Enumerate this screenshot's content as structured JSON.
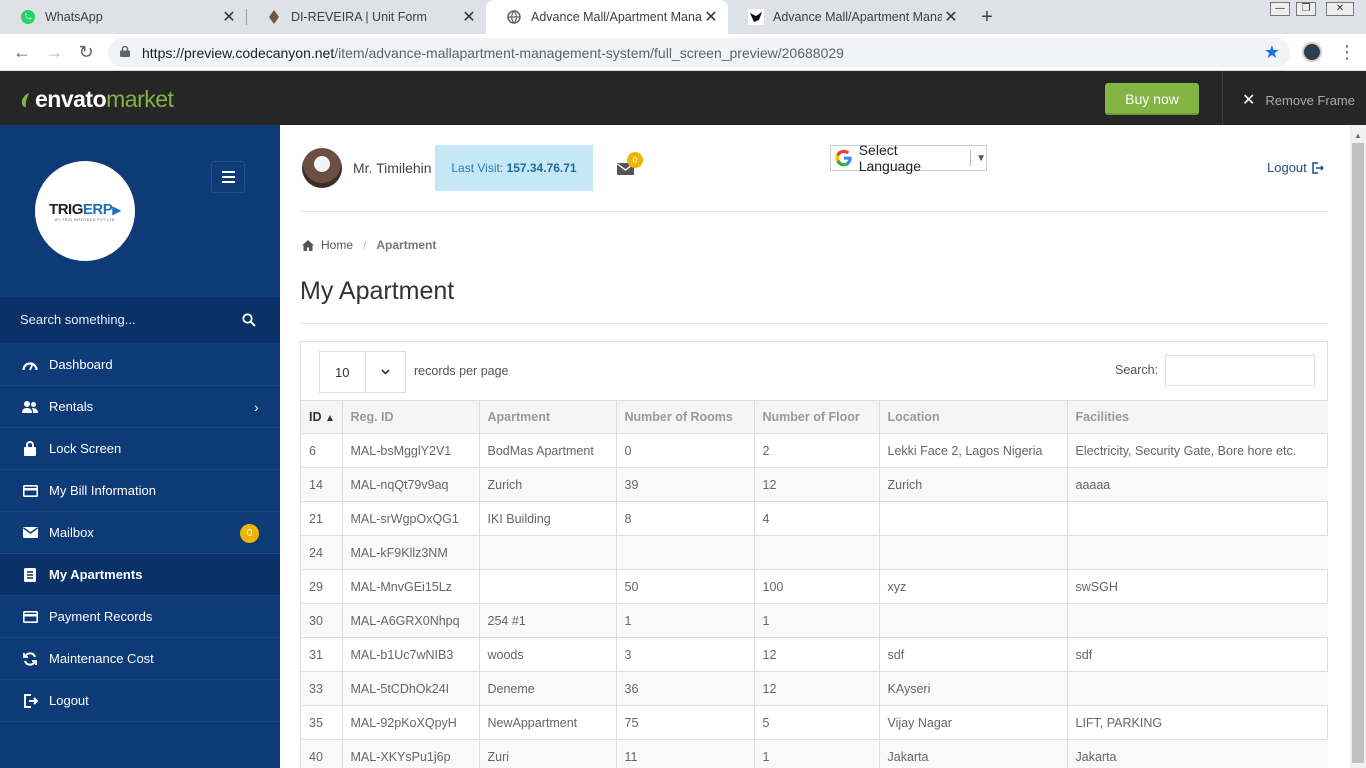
{
  "browser": {
    "tabs": [
      {
        "title": "WhatsApp",
        "icon": "whatsapp-icon"
      },
      {
        "title": "DI-REVEIRA | Unit Form",
        "icon": "diamond-icon"
      },
      {
        "title": "Advance Mall/Apartment Manag",
        "icon": "globe-icon"
      },
      {
        "title": "Advance Mall/Apartment Manag",
        "icon": "bird-icon"
      }
    ],
    "url_host": "https://preview.codecanyon.net",
    "url_path": "/item/advance-mallapartment-management-system/full_screen_preview/20688029"
  },
  "envato": {
    "logo_part1": "envato",
    "logo_part2": "market",
    "buy_now": "Buy now",
    "remove_frame": "Remove Frame",
    "brand_color": "#82b541"
  },
  "sidebar": {
    "logo_main": "TRIG",
    "logo_accent": "ERP",
    "logo_sub": "BY TRIG INFOTECH PVT LTD",
    "search_placeholder": "Search something...",
    "items": [
      {
        "label": "Dashboard",
        "icon": "gauge-icon"
      },
      {
        "label": "Rentals",
        "icon": "users-icon"
      },
      {
        "label": "Lock Screen",
        "icon": "lock-icon"
      },
      {
        "label": "My Bill Information",
        "icon": "card-icon"
      },
      {
        "label": "Mailbox",
        "icon": "envelope-icon",
        "badge": "0"
      },
      {
        "label": "My Apartments",
        "icon": "file-icon"
      },
      {
        "label": "Payment Records",
        "icon": "card-icon"
      },
      {
        "label": "Maintenance Cost",
        "icon": "refresh-icon"
      },
      {
        "label": "Logout",
        "icon": "signout-icon"
      }
    ],
    "bg_color": "#0e3a78"
  },
  "header": {
    "username": "Mr. Timilehin",
    "last_visit_label": "Last Visit:",
    "last_visit_ip": "157.34.76.71",
    "mail_count": "0",
    "language": "Select Language",
    "logout": "Logout"
  },
  "breadcrumb": {
    "home": "Home",
    "current": "Apartment"
  },
  "page_title": "My Apartment",
  "table_controls": {
    "page_length": "10",
    "length_text": "records per page",
    "search_label": "Search:"
  },
  "table": {
    "columns": [
      "ID",
      "Reg. ID",
      "Apartment",
      "Number of Rooms",
      "Number of Floor",
      "Location",
      "Facilities"
    ],
    "rows": [
      [
        "6",
        "MAL-bsMgglY2V1",
        "BodMas Apartment",
        "0",
        "2",
        "Lekki Face 2, Lagos Nigeria",
        "Electricity, Security Gate, Bore hore etc."
      ],
      [
        "14",
        "MAL-nqQt79v9aq",
        "Zurich",
        "39",
        "12",
        "Zurich",
        "aaaaa"
      ],
      [
        "21",
        "MAL-srWgpOxQG1",
        "IKI Building",
        "8",
        "4",
        "",
        ""
      ],
      [
        "24",
        "MAL-kF9Kllz3NM",
        "",
        "",
        "",
        "",
        ""
      ],
      [
        "29",
        "MAL-MnvGEi15Lz",
        "",
        "50",
        "100",
        "xyz",
        "swSGH"
      ],
      [
        "30",
        "MAL-A6GRX0Nhpq",
        "254 #1",
        "1",
        "1",
        "",
        ""
      ],
      [
        "31",
        "MAL-b1Uc7wNIB3",
        "woods",
        "3",
        "12",
        "sdf",
        "sdf"
      ],
      [
        "33",
        "MAL-5tCDhOk24I",
        "Deneme",
        "36",
        "12",
        "KAyseri",
        ""
      ],
      [
        "35",
        "MAL-92pKoXQpyH",
        "NewAppartment",
        "75",
        "5",
        "Vijay Nagar",
        "LIFT, PARKING"
      ],
      [
        "40",
        "MAL-XKYsPu1j6p",
        "Zuri",
        "11",
        "1",
        "Jakarta",
        "Jakarta"
      ]
    ]
  }
}
